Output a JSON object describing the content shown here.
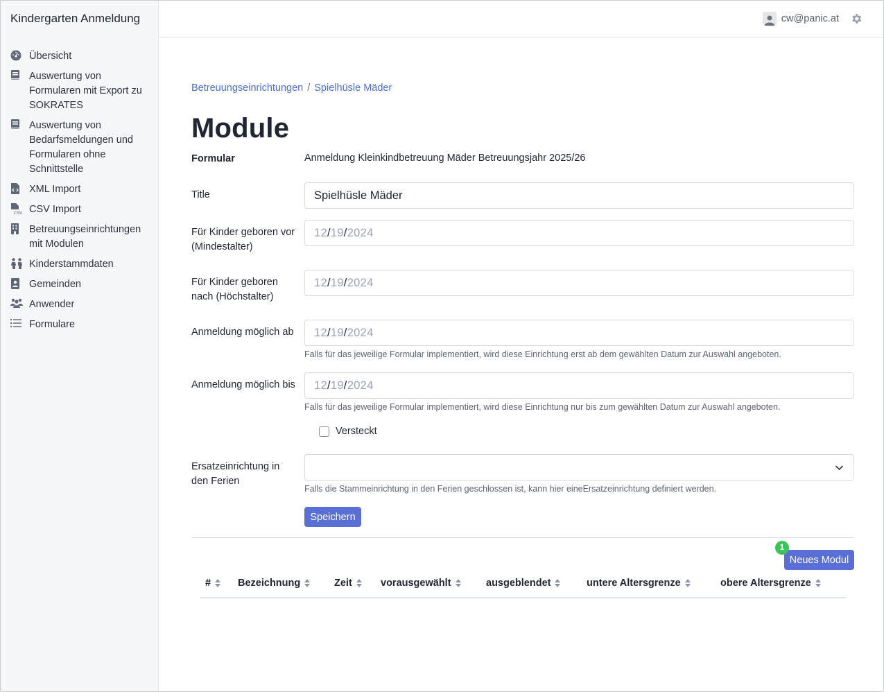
{
  "app": {
    "title": "Kindergarten Anmeldung"
  },
  "sidebar": {
    "items": [
      {
        "label": "Übersicht",
        "icon": "dashboard-icon"
      },
      {
        "label": "Auswertung von Formularen mit Export zu SOKRATES",
        "icon": "book-icon"
      },
      {
        "label": "Auswertung von Bedarfsmeldungen und Formularen ohne Schnittstelle",
        "icon": "book-icon"
      },
      {
        "label": "XML Import",
        "icon": "file-code-icon"
      },
      {
        "label": "CSV Import",
        "icon": "file-csv-icon"
      },
      {
        "label": "Betreuungseinrichtungen mit Modulen",
        "icon": "building-icon"
      },
      {
        "label": "Kinderstammdaten",
        "icon": "children-icon"
      },
      {
        "label": "Gemeinden",
        "icon": "address-book-icon"
      },
      {
        "label": "Anwender",
        "icon": "users-icon"
      },
      {
        "label": "Formulare",
        "icon": "list-icon"
      }
    ]
  },
  "topbar": {
    "user": "cw@panic.at"
  },
  "breadcrumb": {
    "parent": "Betreuungseinrichtungen",
    "separator": "/",
    "current": "Spielhüsle Mäder"
  },
  "page": {
    "title": "Module"
  },
  "form": {
    "formular_label": "Formular",
    "formular_value": "Anmeldung Kleinkindbetreuung Mäder Betreuungsjahr 2025/26",
    "title_label": "Title",
    "title_value": "Spielhüsle Mäder",
    "min_age_label": "Für Kinder geboren vor (Mindestalter)",
    "max_age_label": "Für Kinder geboren nach (Höchstalter)",
    "reg_from_label": "Anmeldung möglich ab",
    "reg_from_help": "Falls für das jeweilige Formular implementiert, wird diese Einrichtung erst ab dem gewählten Datum zur Auswahl angeboten.",
    "reg_to_label": "Anmeldung möglich bis",
    "reg_to_help": "Falls für das jeweilige Formular implementiert, wird diese Einrichtung nur bis zum gewählten Datum zur Auswahl angeboten.",
    "date_placeholder": {
      "mm": "12",
      "dd": "19",
      "yyyy": "2024",
      "sep": "/"
    },
    "hidden_label": "Versteckt",
    "replacement_label": "Ersatzeinrichtung in den Ferien",
    "replacement_value": "",
    "replacement_help": "Falls die Stammeinrichtung in den Ferien geschlossen ist, kann hier eineErsatzeinrichtung definiert werden.",
    "save_label": "Speichern"
  },
  "modules": {
    "new_label": "Neues Modul",
    "badge": "1",
    "columns": [
      "#",
      "Bezeichnung",
      "Zeit",
      "vorausgewählt",
      "ausgeblendet",
      "untere Altersgrenze",
      "obere Altersgrenze"
    ]
  },
  "colors": {
    "primary": "#5a6fd6",
    "link": "#4a6fd6",
    "badge": "#3cc45a"
  }
}
